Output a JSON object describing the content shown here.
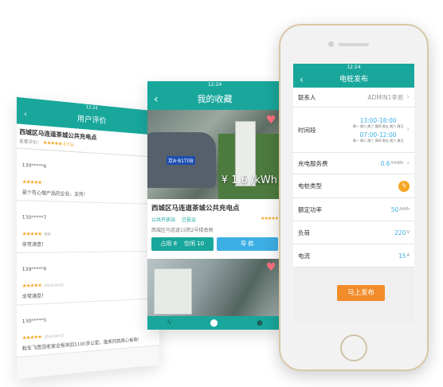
{
  "reviews_screen": {
    "status_time": "12:24",
    "title": "用户评价",
    "station_name": "西城区马连道茶城公共充电点",
    "summary_label": "星星评价：",
    "summary_score": "4.5分",
    "reviews": [
      {
        "user": "130*****6",
        "stars": "★★★★★",
        "date": "",
        "text": "是个有心做产品的企业，支持！"
      },
      {
        "user": "130*****7",
        "stars": "★★★★★",
        "date": "两星",
        "text": "非常满意！"
      },
      {
        "user": "139*****6",
        "stars": "★★★★★",
        "date": "2014-09-02",
        "text": "非常满意！"
      },
      {
        "user": "130*****5",
        "stars": "★★★★★",
        "date": "2014-09-03",
        "text": "和车飞度回老家全程来回1100多公里，能来的就真心省电!"
      }
    ]
  },
  "favorites_screen": {
    "status_time": "12:24",
    "title": "我的收藏",
    "price": "¥ 1.6 /kWh",
    "plate": "京A·B1T0B",
    "station_name": "西城区马连道茶城公共充电点",
    "tag_public": "公共开放站",
    "tag_paid": "已投运",
    "stars": "★★★★★",
    "address": "西城区马连道15院2号楼南侧",
    "occupied_label": "占用 8",
    "free_label": "空闲 10",
    "nav_button": "导 航",
    "tab_icons": [
      "bolt-icon",
      "location-icon",
      "user-icon"
    ]
  },
  "publish_screen": {
    "status_time": "12:24",
    "title": "电桩发布",
    "contact_label": "联系人",
    "contact_value": "ADMIN1李昂",
    "time_label": "时间段",
    "time_range_1": "13:00-18:00",
    "time_range_2": "07:00-12:00",
    "weekdays": "周一 周二 周三 周四 周五 周六 周日",
    "fee_label": "充电服务费",
    "fee_value": "0.6",
    "fee_unit": "¥/kWh",
    "type_label": "电桩类型",
    "power_label": "额定功率",
    "power_value": "50",
    "power_unit": "/kWh",
    "load_label": "负荷",
    "load_value": "220",
    "load_unit": "V",
    "current_label": "电流",
    "current_value": "15",
    "current_unit": "A",
    "submit_label": "马上发布"
  },
  "colors": {
    "teal": "#19a79c",
    "blue": "#3dafe5",
    "orange": "#f28c2a",
    "star": "#f5a623",
    "heart": "#ff6f7d"
  }
}
